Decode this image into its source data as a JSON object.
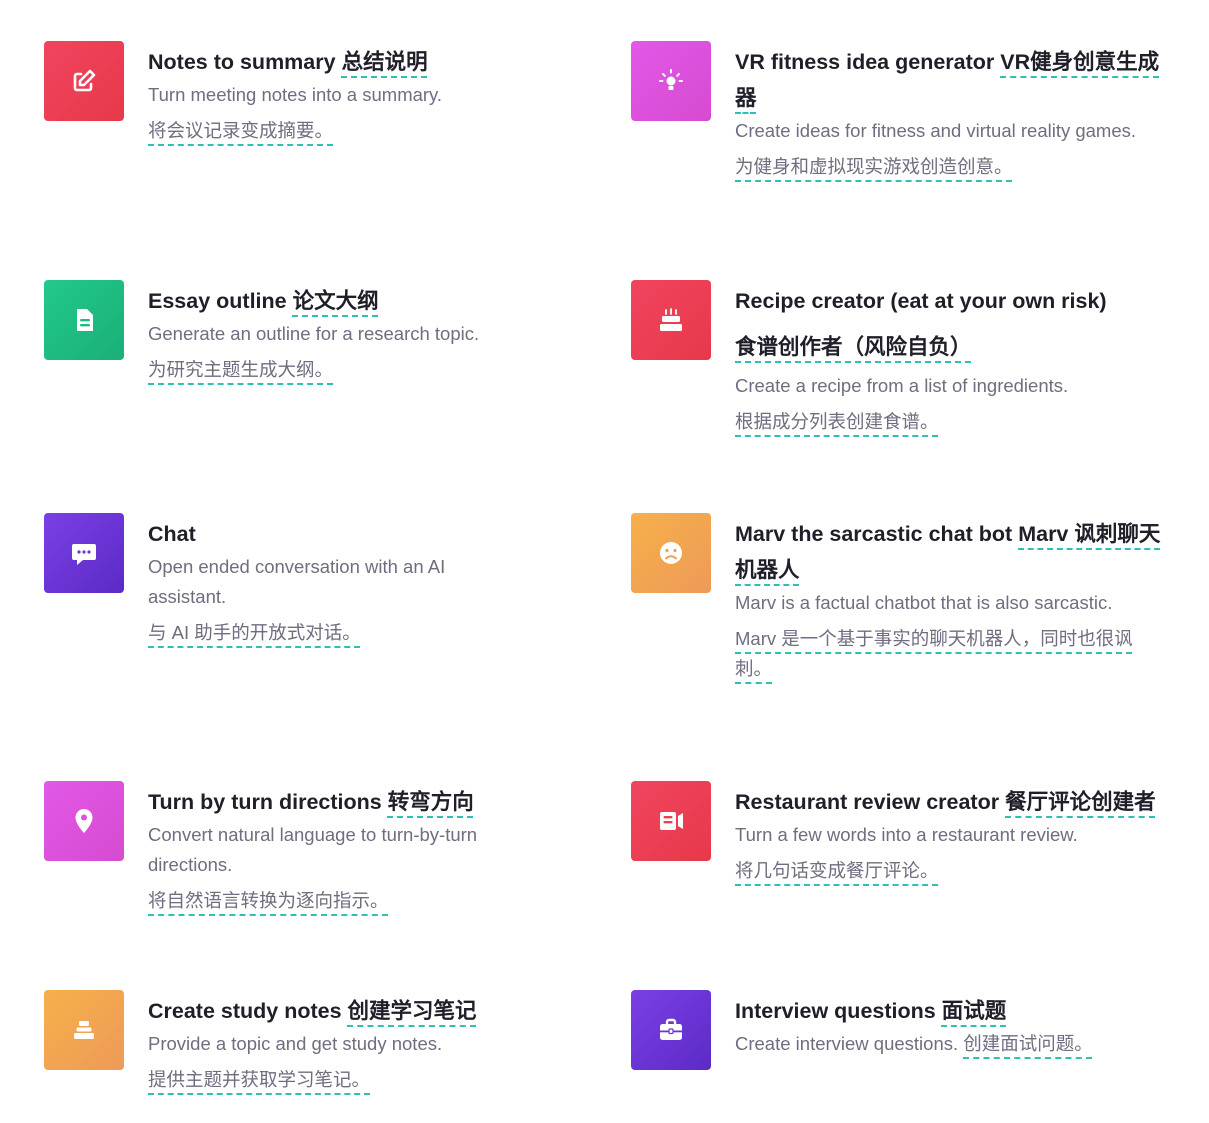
{
  "colors": {
    "accent_underline": "#2fbfb3",
    "title": "#1f1f29",
    "text": "#6e6e80"
  },
  "cards": [
    {
      "title": "Notes to summary",
      "title_zh": "总结说明",
      "desc": "Turn meeting notes into a summary.",
      "desc_zh": "将会议记录变成摘要。",
      "icon": "edit-icon",
      "gradient": [
        "#f0455f",
        "#e8384a"
      ]
    },
    {
      "title": "VR fitness idea generator",
      "title_zh": "VR健身创意生成器",
      "desc": "Create ideas for fitness and virtual reality games.",
      "desc_zh": "为健身和虚拟现实游戏创造创意。",
      "icon": "lightbulb-icon",
      "gradient": [
        "#e258e8",
        "#d64bd0"
      ]
    },
    {
      "title": "Essay outline",
      "title_zh": "论文大纲",
      "desc": "Generate an outline for a research topic.",
      "desc_zh": "为研究主题生成大纲。",
      "icon": "document-icon",
      "gradient": [
        "#22c98a",
        "#1aaf78"
      ]
    },
    {
      "title": "Recipe creator (eat at your own risk)",
      "title_zh": "食谱创作者（风险自负）",
      "desc": "Create a recipe from a list of ingredients.",
      "desc_zh": "根据成分列表创建食谱。",
      "icon": "cake-icon",
      "gradient": [
        "#f0455f",
        "#e8384a"
      ]
    },
    {
      "title": "Chat",
      "title_zh": "",
      "desc": "Open ended conversation with an AI assistant.",
      "desc_zh": "与 AI 助手的开放式对话。",
      "icon": "chat-bubble-icon",
      "gradient": [
        "#7b3fe4",
        "#5b2bc6"
      ]
    },
    {
      "title": "Marv the sarcastic chat bot",
      "title_zh": "Marv 讽刺聊天机器人",
      "desc": "Marv is a factual chatbot that is also sarcastic.",
      "desc_zh": "Marv 是一个基于事实的聊天机器人，同时也很讽刺。",
      "icon": "frown-face-icon",
      "gradient": [
        "#f6b04a",
        "#ee9a58"
      ]
    },
    {
      "title": "Turn by turn directions",
      "title_zh": "转弯方向",
      "desc": "Convert natural language to turn-by-turn directions.",
      "desc_zh": "将自然语言转换为逐向指示。",
      "icon": "map-pin-icon",
      "gradient": [
        "#e258e8",
        "#d64bd0"
      ]
    },
    {
      "title": "Restaurant review creator",
      "title_zh": "餐厅评论创建者",
      "desc": "Turn a few words into a restaurant review.",
      "desc_zh": "将几句话变成餐厅评论。",
      "icon": "review-icon",
      "gradient": [
        "#f0455f",
        "#e8384a"
      ]
    },
    {
      "title": "Create study notes",
      "title_zh": "创建学习笔记",
      "desc": "Provide a topic and get study notes.",
      "desc_zh": "提供主题并获取学习笔记。",
      "icon": "stack-icon",
      "gradient": [
        "#f6b04a",
        "#ee9a58"
      ]
    },
    {
      "title": "Interview questions",
      "title_zh": "面试题",
      "desc": "Create interview questions.",
      "desc_zh": "创建面试问题。",
      "icon": "briefcase-icon",
      "gradient": [
        "#7b3fe4",
        "#5b2bc6"
      ]
    }
  ]
}
